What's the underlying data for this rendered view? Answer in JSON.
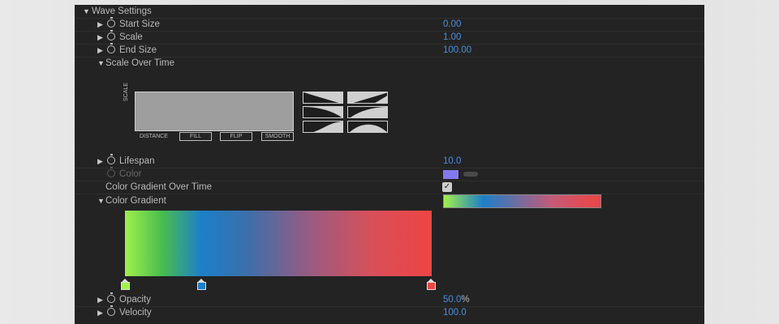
{
  "wave_settings": {
    "header": "Wave Settings",
    "start_size": {
      "label": "Start Size",
      "value": "0.00"
    },
    "scale": {
      "label": "Scale",
      "value": "1.00"
    },
    "end_size": {
      "label": "End Size",
      "value": "100.00"
    }
  },
  "scale_over_time": {
    "label": "Scale Over Time",
    "axis_y": "SCALE",
    "axis_x": "DISTANCE",
    "buttons": [
      "FILL",
      "FLIP",
      "SMOOTH"
    ]
  },
  "lifespan": {
    "label": "Lifespan",
    "value": "10.0"
  },
  "color": {
    "label": "Color",
    "swatch": "#8379ee"
  },
  "color_gradient_over_time": {
    "label": "Color Gradient Over Time",
    "checked": true
  },
  "color_gradient": {
    "label": "Color Gradient",
    "stops": [
      "#a4f04a",
      "#1d7fc8",
      "#ee4444"
    ]
  },
  "opacity": {
    "label": "Opacity",
    "value": "50.0",
    "unit": "%"
  },
  "velocity": {
    "label": "Velocity",
    "value": "100.0"
  }
}
